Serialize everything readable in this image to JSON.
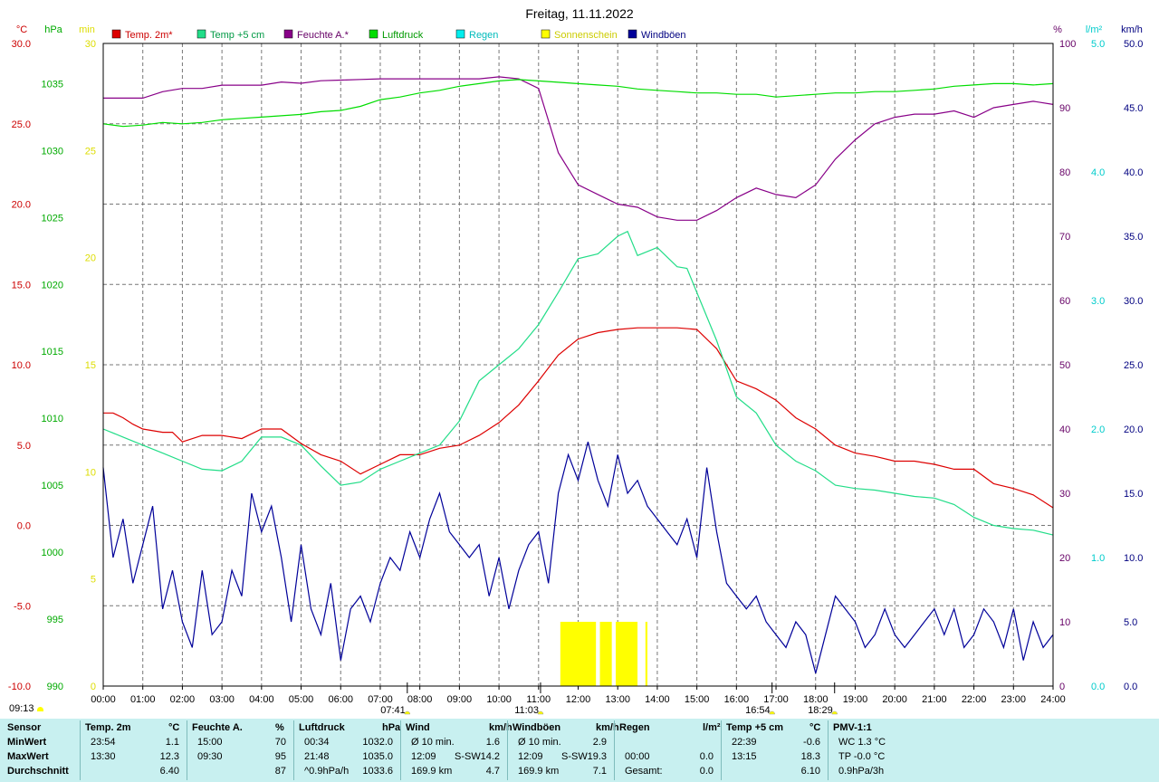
{
  "chart_data": {
    "type": "line",
    "title": "Freitag, 11.11.2022",
    "x_labels": [
      "00:00",
      "01:00",
      "02:00",
      "03:00",
      "04:00",
      "05:00",
      "06:00",
      "07:00",
      "08:00",
      "09:00",
      "10:00",
      "11:00",
      "12:00",
      "13:00",
      "14:00",
      "15:00",
      "16:00",
      "17:00",
      "18:00",
      "19:00",
      "20:00",
      "21:00",
      "22:00",
      "23:00",
      "24:00"
    ],
    "grid": true,
    "axes": {
      "temp": {
        "unit": "°C",
        "ticks": [
          "30.0",
          "25.0",
          "20.0",
          "15.0",
          "10.0",
          "5.0",
          "0.0",
          "-5.0",
          "-10.0"
        ],
        "range": [
          -10,
          30
        ],
        "color": "#cc0000"
      },
      "press": {
        "unit": "hPa",
        "ticks": [
          "1035",
          "1030",
          "1025",
          "1020",
          "1015",
          "1010",
          "1005",
          "1000",
          "995",
          "990"
        ],
        "range": [
          990,
          1038
        ],
        "color": "#00aa00"
      },
      "sun": {
        "unit": "min",
        "ticks": [
          "30",
          "25",
          "20",
          "15",
          "10",
          "5",
          "0"
        ],
        "range": [
          0,
          30
        ],
        "color": "#dddd00"
      },
      "hum": {
        "unit": "%",
        "ticks": [
          "100",
          "90",
          "80",
          "70",
          "60",
          "50",
          "40",
          "30",
          "20",
          "10",
          "0"
        ],
        "range": [
          0,
          100
        ],
        "color": "#660066"
      },
      "rain": {
        "unit": "l/m²",
        "ticks": [
          "5.0",
          "4.0",
          "3.0",
          "2.0",
          "1.0",
          "0.0"
        ],
        "range": [
          0,
          5
        ],
        "color": "#00cccc"
      },
      "wind": {
        "unit": "km/h",
        "ticks": [
          "50.0",
          "45.0",
          "40.0",
          "35.0",
          "30.0",
          "25.0",
          "20.0",
          "15.0",
          "10.0",
          "5.0",
          "0.0"
        ],
        "range": [
          0,
          50
        ],
        "color": "#000080"
      }
    },
    "legend": [
      {
        "name": "Temp. 2m*",
        "color": "#dd0000",
        "text_color": "#cc0000"
      },
      {
        "name": "Temp +5 cm",
        "color": "#22dd88",
        "text_color": "#009944"
      },
      {
        "name": "Feuchte A.*",
        "color": "#880088",
        "text_color": "#660066"
      },
      {
        "name": "Luftdruck",
        "color": "#00dd00",
        "text_color": "#009900"
      },
      {
        "name": "Regen",
        "color": "#00eeee",
        "text_color": "#00bbbb"
      },
      {
        "name": "Sonnenschein",
        "color": "#ffff00",
        "text_color": "#cccc00"
      },
      {
        "name": "Windböen",
        "color": "#000099",
        "text_color": "#000080"
      }
    ],
    "series": [
      {
        "name": "Temp. 2m*",
        "axis": "temp",
        "color": "#dd0000",
        "x": [
          0,
          0.25,
          0.5,
          0.75,
          1.0,
          1.5,
          1.75,
          2.0,
          2.5,
          3.0,
          3.5,
          4.0,
          4.5,
          5.0,
          5.5,
          6.0,
          6.5,
          7.0,
          7.5,
          8.0,
          8.5,
          9.0,
          9.5,
          10.0,
          10.5,
          11.0,
          11.5,
          12.0,
          12.5,
          13.0,
          13.5,
          14.0,
          14.5,
          15.0,
          15.5,
          16.0,
          16.5,
          17.0,
          17.5,
          18.0,
          18.5,
          19.0,
          19.5,
          20.0,
          20.5,
          21.0,
          21.5,
          22.0,
          22.5,
          23.0,
          23.5,
          24.0
        ],
        "y": [
          7.0,
          7.0,
          6.7,
          6.3,
          6.0,
          5.8,
          5.8,
          5.2,
          5.6,
          5.6,
          5.4,
          6.0,
          6.0,
          5.1,
          4.4,
          4.0,
          3.2,
          3.8,
          4.4,
          4.4,
          4.8,
          5.0,
          5.6,
          6.4,
          7.5,
          9.0,
          10.6,
          11.6,
          12.0,
          12.2,
          12.3,
          12.3,
          12.3,
          12.2,
          11.0,
          9.0,
          8.5,
          7.8,
          6.7,
          6.0,
          5.0,
          4.5,
          4.3,
          4.0,
          4.0,
          3.8,
          3.5,
          3.5,
          2.6,
          2.3,
          1.9,
          1.1
        ]
      },
      {
        "name": "Temp +5 cm",
        "axis": "temp",
        "color": "#22dd88",
        "x": [
          0,
          0.5,
          1.0,
          1.5,
          2.0,
          2.5,
          3.0,
          3.5,
          4.0,
          4.5,
          5.0,
          5.5,
          6.0,
          6.5,
          7.0,
          7.5,
          8.0,
          8.5,
          9.0,
          9.5,
          10.0,
          10.5,
          11.0,
          11.5,
          12.0,
          12.5,
          13.0,
          13.25,
          13.5,
          14.0,
          14.5,
          14.75,
          15.0,
          15.5,
          16.0,
          16.5,
          17.0,
          17.5,
          18.0,
          18.5,
          19.0,
          19.5,
          20.0,
          20.5,
          21.0,
          21.5,
          22.0,
          22.5,
          23.0,
          23.5,
          24.0
        ],
        "y": [
          6.0,
          5.5,
          5.0,
          4.5,
          4.0,
          3.5,
          3.4,
          4.0,
          5.5,
          5.5,
          5.0,
          3.7,
          2.5,
          2.7,
          3.5,
          4.0,
          4.5,
          5.0,
          6.5,
          9.0,
          10.0,
          11.0,
          12.5,
          14.5,
          16.6,
          16.9,
          18.0,
          18.3,
          16.8,
          17.3,
          16.1,
          16.0,
          14.5,
          11.5,
          8.0,
          7.0,
          5.0,
          4.0,
          3.4,
          2.5,
          2.3,
          2.2,
          2.0,
          1.8,
          1.7,
          1.3,
          0.5,
          0.0,
          -0.2,
          -0.3,
          -0.6
        ]
      },
      {
        "name": "Feuchte A.*",
        "axis": "hum",
        "color": "#880088",
        "x": [
          0,
          0.5,
          1.0,
          1.5,
          2.0,
          2.5,
          3.0,
          3.5,
          4.0,
          4.5,
          5.0,
          5.5,
          6.0,
          6.5,
          7.0,
          7.5,
          8.0,
          8.5,
          9.0,
          9.5,
          10.0,
          10.5,
          11.0,
          11.25,
          11.5,
          12.0,
          12.5,
          13.0,
          13.5,
          14.0,
          14.5,
          15.0,
          15.5,
          16.0,
          16.5,
          17.0,
          17.5,
          18.0,
          18.5,
          19.0,
          19.5,
          20.0,
          20.5,
          21.0,
          21.5,
          22.0,
          22.5,
          23.0,
          23.5,
          24.0
        ],
        "y": [
          91.5,
          91.5,
          91.5,
          92.5,
          93.0,
          93.0,
          93.5,
          93.5,
          93.5,
          94.0,
          93.8,
          94.2,
          94.3,
          94.4,
          94.5,
          94.5,
          94.5,
          94.5,
          94.5,
          94.5,
          94.8,
          94.5,
          93.0,
          88.0,
          83.0,
          78.0,
          76.5,
          75.0,
          74.5,
          73.0,
          72.5,
          72.5,
          74.0,
          76.0,
          77.5,
          76.5,
          76.0,
          78.0,
          82.0,
          85.0,
          87.5,
          88.5,
          89.0,
          89.0,
          89.5,
          88.5,
          90.0,
          90.5,
          91.0,
          90.5
        ]
      },
      {
        "name": "Luftdruck",
        "axis": "press",
        "color": "#00dd00",
        "x": [
          0,
          0.5,
          1.0,
          1.5,
          2.0,
          2.5,
          3.0,
          3.5,
          4.0,
          4.5,
          5.0,
          5.5,
          6.0,
          6.5,
          7.0,
          7.5,
          8.0,
          8.5,
          9.0,
          9.5,
          10.0,
          10.5,
          11.0,
          11.5,
          12.0,
          12.5,
          13.0,
          13.5,
          14.0,
          14.5,
          15.0,
          15.5,
          16.0,
          16.5,
          17.0,
          17.5,
          18.0,
          18.5,
          19.0,
          19.5,
          20.0,
          20.5,
          21.0,
          21.5,
          22.0,
          22.5,
          23.0,
          23.5,
          24.0
        ],
        "y": [
          1032.0,
          1031.8,
          1031.9,
          1032.1,
          1032.0,
          1032.1,
          1032.3,
          1032.4,
          1032.5,
          1032.6,
          1032.7,
          1032.9,
          1033.0,
          1033.3,
          1033.8,
          1034.0,
          1034.3,
          1034.5,
          1034.8,
          1035.0,
          1035.2,
          1035.3,
          1035.2,
          1035.1,
          1035.0,
          1034.9,
          1034.8,
          1034.6,
          1034.5,
          1034.4,
          1034.3,
          1034.3,
          1034.2,
          1034.2,
          1034.0,
          1034.1,
          1034.2,
          1034.3,
          1034.3,
          1034.4,
          1034.4,
          1034.5,
          1034.6,
          1034.8,
          1034.9,
          1035.0,
          1035.0,
          1034.9,
          1035.0
        ]
      },
      {
        "name": "Windböen",
        "axis": "wind",
        "color": "#000099",
        "x": [
          0,
          0.25,
          0.5,
          0.75,
          1.0,
          1.25,
          1.5,
          1.75,
          2.0,
          2.25,
          2.5,
          2.75,
          3.0,
          3.25,
          3.5,
          3.75,
          4.0,
          4.25,
          4.5,
          4.75,
          5.0,
          5.25,
          5.5,
          5.75,
          6.0,
          6.25,
          6.5,
          6.75,
          7.0,
          7.25,
          7.5,
          7.75,
          8.0,
          8.25,
          8.5,
          8.75,
          9.0,
          9.25,
          9.5,
          9.75,
          10.0,
          10.25,
          10.5,
          10.75,
          11.0,
          11.25,
          11.5,
          11.75,
          12.0,
          12.25,
          12.5,
          12.75,
          13.0,
          13.25,
          13.5,
          13.75,
          14.0,
          14.25,
          14.5,
          14.75,
          15.0,
          15.25,
          15.5,
          15.75,
          16.0,
          16.25,
          16.5,
          16.75,
          17.0,
          17.25,
          17.5,
          17.75,
          18.0,
          18.25,
          18.5,
          18.75,
          19.0,
          19.25,
          19.5,
          19.75,
          20.0,
          20.25,
          20.5,
          20.75,
          21.0,
          21.25,
          21.5,
          21.75,
          22.0,
          22.25,
          22.5,
          22.75,
          23.0,
          23.25,
          23.5,
          23.75,
          24.0
        ],
        "y": [
          17,
          10,
          13,
          8,
          11,
          14,
          6,
          9,
          5,
          3,
          9,
          4,
          5,
          9,
          7,
          15,
          12,
          14,
          10,
          5,
          11,
          6,
          4,
          8,
          2,
          6,
          7,
          5,
          8,
          10,
          9,
          12,
          10,
          13,
          15,
          12,
          11,
          10,
          11,
          7,
          10,
          6,
          9,
          11,
          12,
          8,
          15,
          18,
          16,
          19,
          16,
          14,
          18,
          15,
          16,
          14,
          13,
          12,
          11,
          13,
          10,
          17,
          12,
          8,
          7,
          6,
          7,
          5,
          4,
          3,
          5,
          4,
          1,
          4,
          7,
          6,
          5,
          3,
          4,
          6,
          4,
          3,
          4,
          5,
          6,
          4,
          6,
          3,
          4,
          6,
          5,
          3,
          6,
          2,
          5,
          3,
          4
        ]
      }
    ],
    "sunshine_bars": {
      "axis": "sun",
      "color": "#ffff00",
      "segments": [
        {
          "from": 11.55,
          "to": 12.45,
          "value": 3
        },
        {
          "from": 12.55,
          "to": 12.85,
          "value": 3
        },
        {
          "from": 12.95,
          "to": 13.5,
          "value": 3
        },
        {
          "from": 13.7,
          "to": 13.75,
          "value": 3
        }
      ]
    },
    "markers": [
      {
        "hour": 7.683,
        "label": "07:41",
        "color": "#ffff00"
      },
      {
        "hour": 11.05,
        "label": "11:03",
        "color": "#ffff00"
      },
      {
        "hour": 16.9,
        "label": "16:54",
        "color": "#ffff00"
      },
      {
        "hour": 18.48,
        "label": "18:29",
        "color": "#ffff00"
      }
    ]
  },
  "footer": {
    "corner_time": "09:13",
    "row_labels": [
      "Sensor",
      "MinWert",
      "MaxWert",
      "Durchschnitt"
    ],
    "sections": [
      {
        "title": "Temp. 2m",
        "unit": "°C",
        "rows": [
          [
            "23:54",
            "",
            "1.1"
          ],
          [
            "13:30",
            "",
            "12.3"
          ],
          [
            "",
            "",
            "6.40"
          ]
        ]
      },
      {
        "title": "Feuchte A.",
        "unit": "%",
        "rows": [
          [
            "15:00",
            "",
            "70"
          ],
          [
            "09:30",
            "",
            "95"
          ],
          [
            "",
            "",
            "87"
          ]
        ]
      },
      {
        "title": "Luftdruck",
        "unit": "hPa",
        "rows": [
          [
            "00:34",
            "",
            "1032.0"
          ],
          [
            "21:48",
            "",
            "1035.0"
          ],
          [
            "^0.9hPa/h",
            "",
            "1033.6"
          ]
        ]
      },
      {
        "title": "Wind",
        "unit": "km/h",
        "rows": [
          [
            "Ø 10 min.",
            "",
            "1.6"
          ],
          [
            "12:09",
            "S-SW",
            "14.2"
          ],
          [
            "169.9 km",
            "",
            "4.7"
          ]
        ]
      },
      {
        "title": "Windböen",
        "unit": "km/h",
        "rows": [
          [
            "Ø 10 min.",
            "",
            "2.9"
          ],
          [
            "12:09",
            "S-SW",
            "19.3"
          ],
          [
            "169.9 km",
            "",
            "7.1"
          ]
        ]
      },
      {
        "title": "Regen",
        "unit": "l/m²",
        "rows": [
          [
            "",
            "",
            ""
          ],
          [
            "00:00",
            "",
            "0.0"
          ],
          [
            "Gesamt:",
            "",
            "0.0"
          ]
        ]
      },
      {
        "title": "Temp +5 cm",
        "unit": "°C",
        "rows": [
          [
            "22:39",
            "",
            "-0.6"
          ],
          [
            "13:15",
            "",
            "18.3"
          ],
          [
            "",
            "",
            "6.10"
          ]
        ]
      },
      {
        "title": "PMV-1:1",
        "unit": "",
        "rows": [
          [
            "WC 1.3 °C",
            "",
            ""
          ],
          [
            "TP -0.0 °C",
            "",
            ""
          ],
          [
            "0.9hPa/3h",
            "",
            ""
          ]
        ]
      }
    ]
  }
}
